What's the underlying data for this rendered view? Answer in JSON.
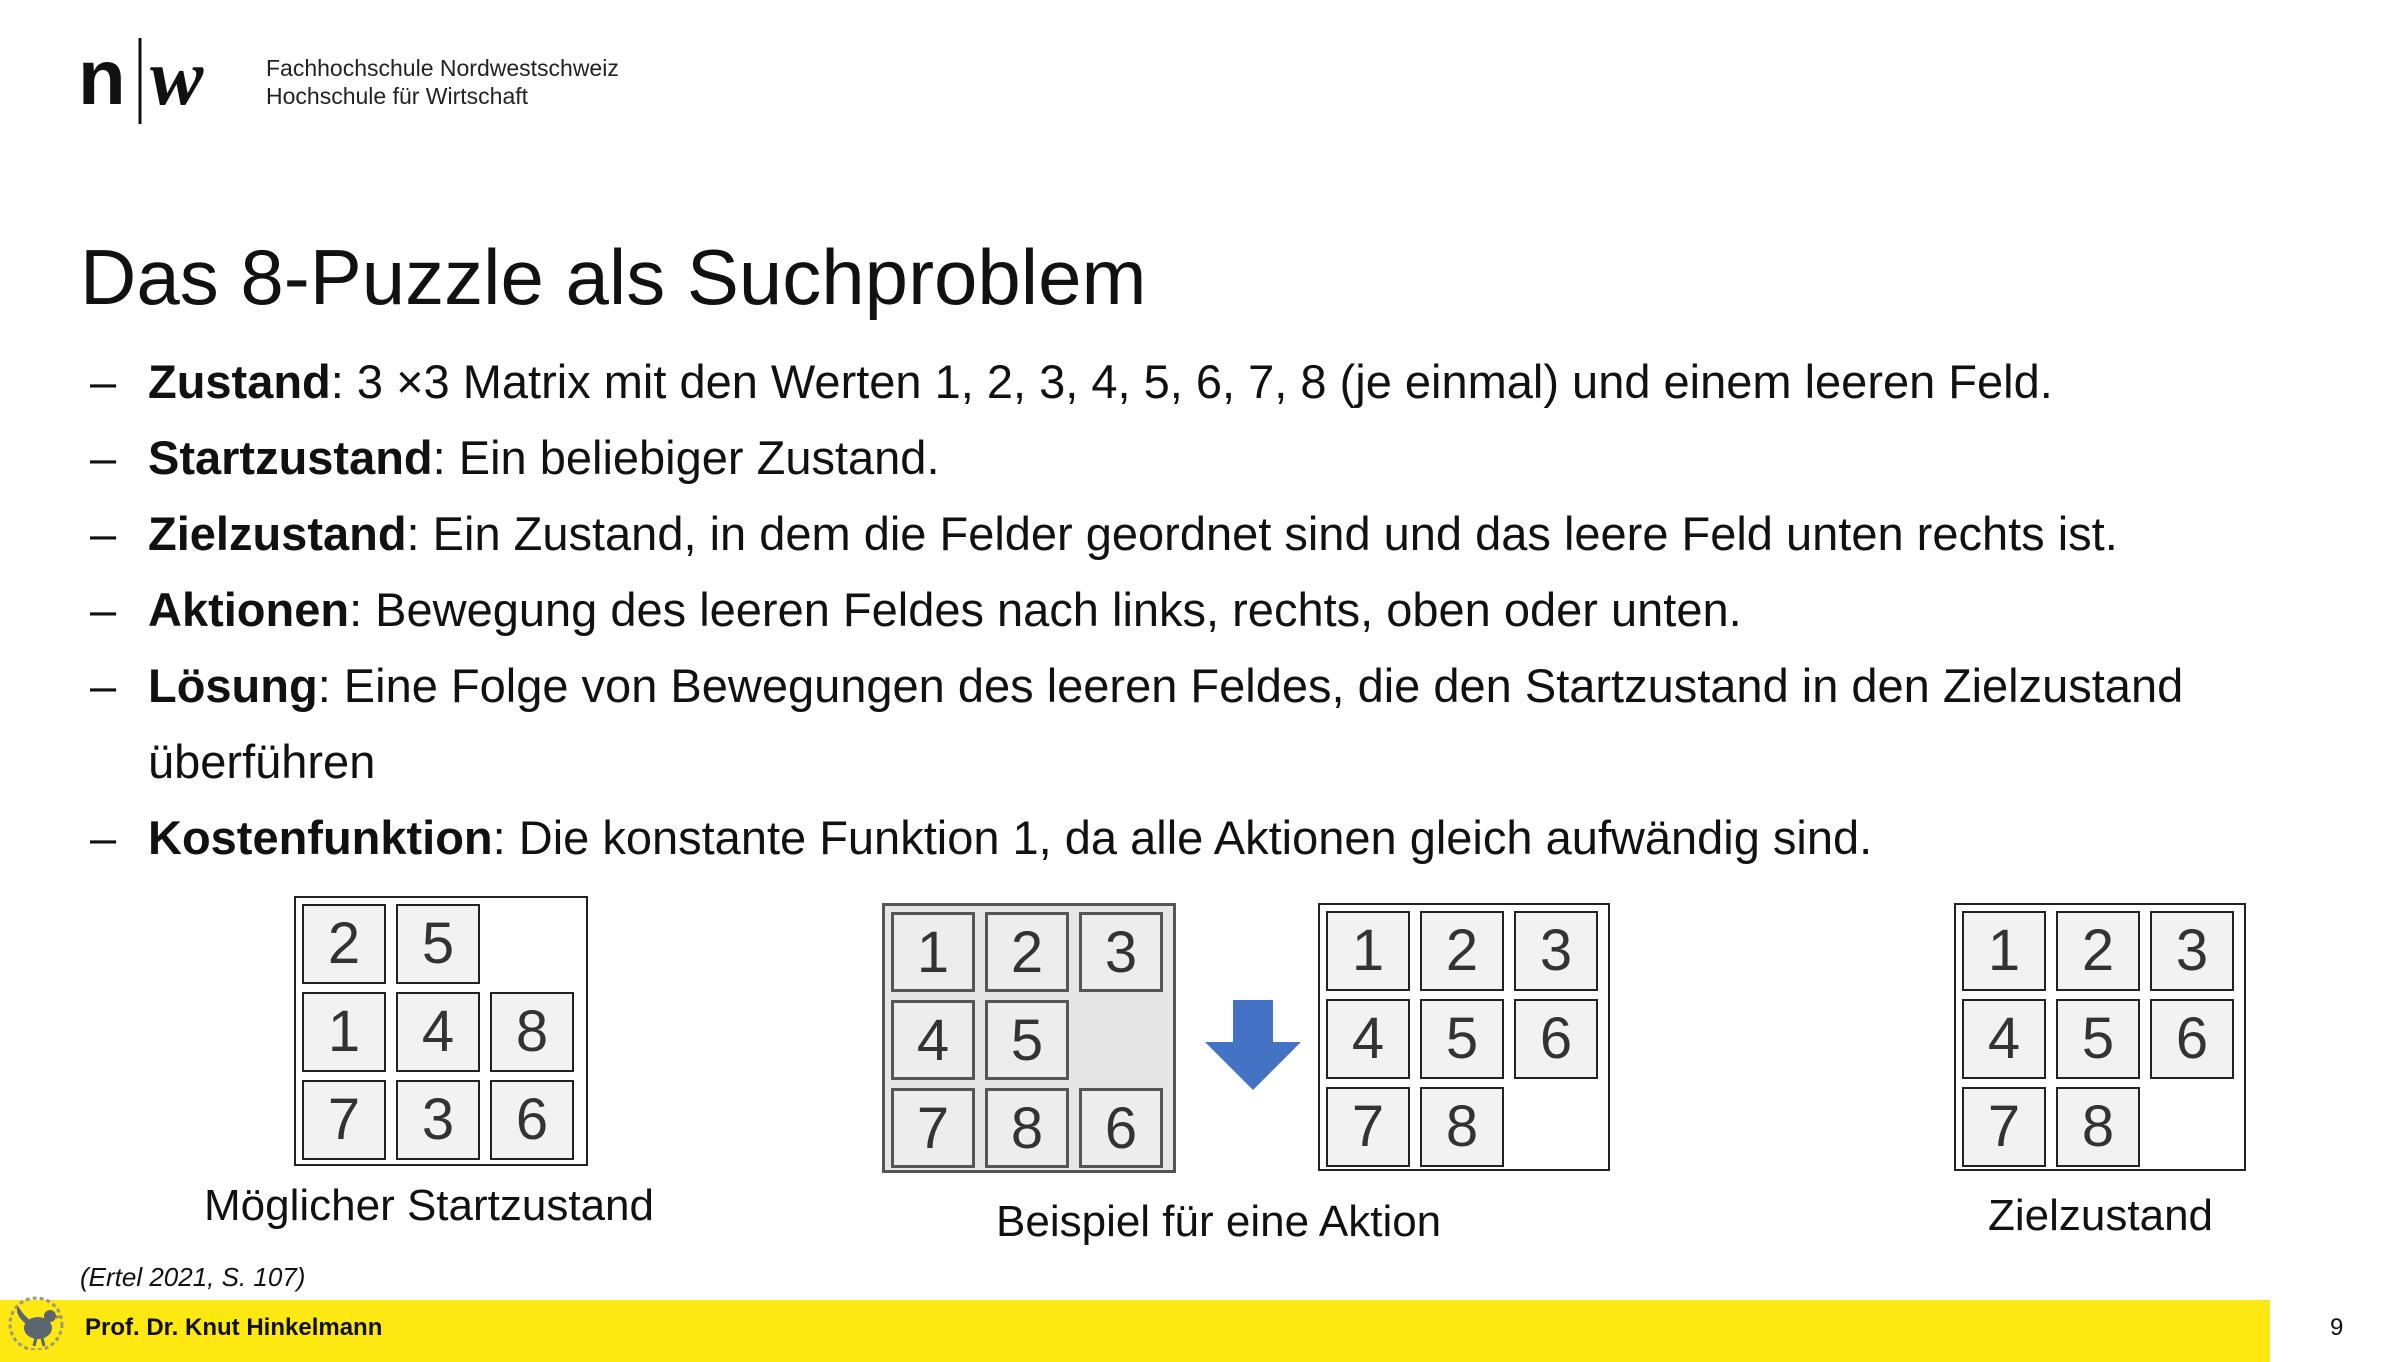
{
  "header": {
    "logo_left": "n",
    "logo_right": "w",
    "org_line1": "Fachhochschule Nordwestschweiz",
    "org_line2": "Hochschule für Wirtschaft"
  },
  "slide": {
    "title": "Das 8-Puzzle als Suchproblem",
    "bullets": [
      {
        "dash": "–",
        "term": "Zustand",
        "text": ": 3 ×3 Matrix mit den Werten 1, 2, 3, 4, 5, 6, 7, 8 (je einmal) und einem leeren Feld."
      },
      {
        "dash": "–",
        "term": "Startzustand",
        "text": ": Ein beliebiger Zustand."
      },
      {
        "dash": "–",
        "term": "Zielzustand",
        "text": ": Ein Zustand, in dem die Felder geordnet sind und das leere Feld unten rechts ist."
      },
      {
        "dash": "–",
        "term": "Aktionen",
        "text": ": Bewegung des leeren Feldes nach links, rechts, oben oder unten."
      },
      {
        "dash": "–",
        "term": "Lösung",
        "text": ": Eine Folge von Bewegungen des leeren Feldes, die den Startzustand in den Zielzustand überführen"
      },
      {
        "dash": "–",
        "term": "Kostenfunktion",
        "text": ": Die konstante Funktion 1, da alle Aktionen gleich aufwändig sind."
      }
    ]
  },
  "puzzles": {
    "start": [
      "2",
      "5",
      "",
      "1",
      "4",
      "8",
      "7",
      "3",
      "6"
    ],
    "action_before": [
      "1",
      "2",
      "3",
      "4",
      "5",
      "",
      "7",
      "8",
      "6"
    ],
    "action_after": [
      "1",
      "2",
      "3",
      "4",
      "5",
      "6",
      "7",
      "8",
      ""
    ],
    "goal": [
      "1",
      "2",
      "3",
      "4",
      "5",
      "6",
      "7",
      "8",
      ""
    ]
  },
  "captions": {
    "start": "Möglicher Startzustand",
    "action": "Beispiel für eine Aktion",
    "goal": "Zielzustand"
  },
  "colors": {
    "arrow": "#4472c4",
    "footer": "#fde811"
  },
  "citation": "(Ertel 2021, S. 107)",
  "footer": {
    "presenter": "Prof. Dr. Knut Hinkelmann",
    "page_number": "9"
  }
}
